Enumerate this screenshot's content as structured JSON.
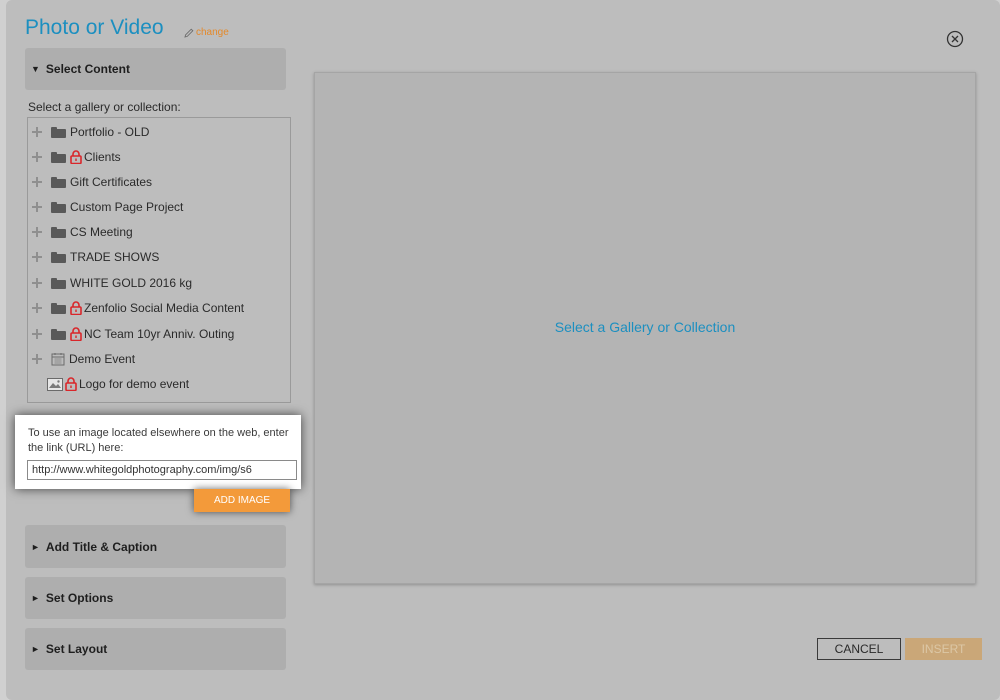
{
  "dialog": {
    "title": "Photo or Video",
    "change_label": "change"
  },
  "sections": {
    "select_content": "Select Content",
    "add_title_caption": "Add Title & Caption",
    "set_options": "Set Options",
    "set_layout": "Set Layout"
  },
  "tree": {
    "label": "Select a gallery or collection:",
    "items": [
      {
        "label": "Portfolio - OLD",
        "icon": "folder-icon",
        "locked": false
      },
      {
        "label": "Clients",
        "icon": "folder-icon",
        "locked": true
      },
      {
        "label": "Gift Certificates",
        "icon": "folder-icon",
        "locked": false
      },
      {
        "label": "Custom Page Project",
        "icon": "folder-icon",
        "locked": false
      },
      {
        "label": "CS Meeting",
        "icon": "folder-icon",
        "locked": false
      },
      {
        "label": "TRADE SHOWS",
        "icon": "folder-icon",
        "locked": false
      },
      {
        "label": "WHITE GOLD 2016 kg",
        "icon": "folder-icon",
        "locked": false
      },
      {
        "label": "Zenfolio Social Media Content",
        "icon": "folder-icon",
        "locked": true
      },
      {
        "label": "NC Team 10yr Anniv. Outing",
        "icon": "folder-icon",
        "locked": true
      },
      {
        "label": "Demo Event",
        "icon": "calendar-icon",
        "locked": false
      },
      {
        "label": "Logo for demo event",
        "icon": "image-icon",
        "locked": true
      }
    ]
  },
  "url_panel": {
    "instructions": "To use an image located elsewhere on the web, enter the link (URL) here:",
    "url_value": "http://www.whitegoldphotography.com/img/s6",
    "add_image_label": "ADD IMAGE"
  },
  "preview": {
    "message": "Select a Gallery or Collection"
  },
  "footer": {
    "cancel_label": "CANCEL",
    "insert_label": "INSERT"
  },
  "colors": {
    "accent_blue": "#1c8fc0",
    "accent_orange": "#f39a3a",
    "lock_red": "#d9262a"
  }
}
